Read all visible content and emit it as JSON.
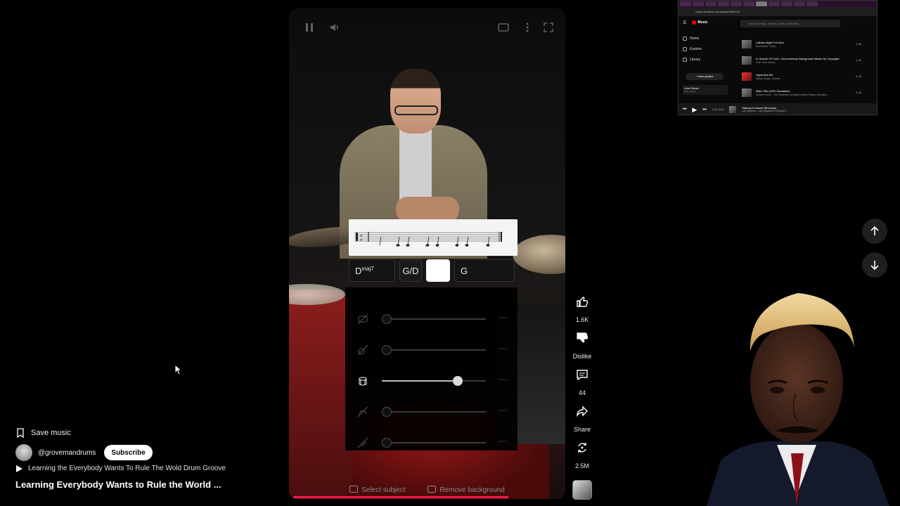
{
  "video": {
    "chords": [
      "D",
      "maj7",
      "G/D",
      "G"
    ],
    "bottom_bar": {
      "select_subject": "Select subject",
      "remove_background": "Remove background"
    }
  },
  "actions": {
    "like_count": "1.6K",
    "dislike_label": "Dislike",
    "comments_count": "44",
    "share_label": "Share",
    "remix_count": "2.5M"
  },
  "info": {
    "save_label": "Save music",
    "channel_handle": "@grovemandrums",
    "subscribe_label": "Subscribe",
    "playlist_line": "Learning the Everybody Wants To Rule The Wold Drum Groove",
    "title": "Learning Everybody Wants to Rule the World ..."
  },
  "mini_browser": {
    "url": "music.youtube.com/playlist?list=LM",
    "app_name": "Music",
    "search_placeholder": "Search songs, albums, artists, podcasts",
    "sidebar": [
      "Home",
      "Explore",
      "Library"
    ],
    "new_playlist": "+ New playlist",
    "liked_music": "Liked Music",
    "liked_sub": "Auto playlist",
    "tracks": [
      {
        "title": "Laibaw Night Full Intro",
        "artist": "Sometimes Trump",
        "duration": "1:45"
      },
      {
        "title": "In Search Of Truth - Documentary Background Music No Copyright",
        "artist": "Free Tone Library",
        "duration": "1:45"
      },
      {
        "title": "Hypnotize Me",
        "artist": "Wang Chung - Mosaic",
        "duration": "4:45"
      },
      {
        "title": "Main Title (2020 Remaster)",
        "artist": "James Horner - The Rocketeer (Original Motion Picture Soundtra...",
        "duration": "4:45"
      }
    ],
    "now_playing": {
      "title": "Stairway to Heaven (Remaster)",
      "artist": "Led Zeppelin - Led Zeppelin IV (Deluxe E",
      "time": "0:00 / 8:03"
    }
  },
  "colors": {
    "progress": "#ff1a4e",
    "accent": "#ffffff",
    "background": "#000000"
  }
}
